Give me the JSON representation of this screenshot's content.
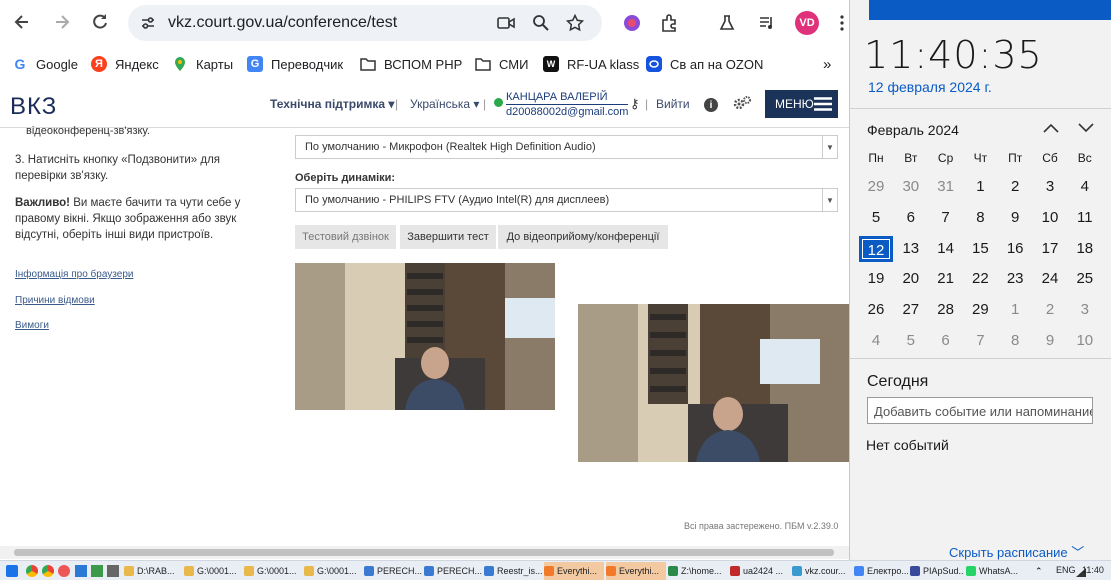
{
  "browser": {
    "url": "vkz.court.gov.ua/conference/test",
    "avatar_initials": "VD",
    "accent": "#e0327a"
  },
  "bookmarks": [
    {
      "label": "Google",
      "icon": "google-icon"
    },
    {
      "label": "Яндекс",
      "icon": "yandex-icon"
    },
    {
      "label": "Карты",
      "icon": "maps-pin-icon"
    },
    {
      "label": "Переводчик",
      "icon": "translate-icon"
    },
    {
      "label": "ВСПОМ PHP",
      "icon": "folder-icon"
    },
    {
      "label": "СМИ",
      "icon": "folder-icon"
    },
    {
      "label": "RF-UA klass",
      "icon": "rf-ua-icon"
    },
    {
      "label": "Св ап на OZON",
      "icon": "ozon-icon"
    }
  ],
  "site": {
    "logo": "ВКЗ",
    "support": "Технічна підтримка",
    "language": "Українська",
    "user_name": "КАНЦАРА ВАЛЕРІЙ",
    "user_email": "d20088002d@gmail.com",
    "logout": "Вийти",
    "menu": "МЕНЮ",
    "brand_color": "#1b3358"
  },
  "instructions": {
    "item2_tail": "відеоконференц-зв'язку.",
    "item3": "3. Натисніть кнопку «Подзвонити» для перевірки зв'язку.",
    "item4_bold": "Важливо!",
    "item4_text": " Ви маєте бачити та чути себе у правому вікні. Якщо зображення або звук відсутні, оберіть інші види пристроїв.",
    "links": [
      "Інформація про браузери",
      "Причини відмови",
      "Вимоги"
    ]
  },
  "form": {
    "microphone_value": "По умолчанию - Микрофон (Realtek High Definition Audio)",
    "speaker_label": "Оберіть динаміки:",
    "speaker_value": "По умолчанию - PHILIPS FTV (Аудио Intel(R) для дисплеев)",
    "btn_test_call": "Тестовий дзвінок",
    "btn_end_test": "Завершити тест",
    "btn_to_reception": "До відеоприйому/конференції"
  },
  "footer": "Всі права застережено. ПБМ v.2.39.0",
  "calendar": {
    "time": "11:40:35",
    "date": "12 февраля 2024 г.",
    "month": "Февраль 2024",
    "weekdays": [
      "Пн",
      "Вт",
      "Ср",
      "Чт",
      "Пт",
      "Сб",
      "Вс"
    ],
    "days": [
      "29",
      "30",
      "31",
      "1",
      "2",
      "3",
      "4",
      "5",
      "6",
      "7",
      "8",
      "9",
      "10",
      "11",
      "12",
      "13",
      "14",
      "15",
      "16",
      "17",
      "18",
      "19",
      "20",
      "21",
      "22",
      "23",
      "24",
      "25",
      "26",
      "27",
      "28",
      "29",
      "1",
      "2",
      "3",
      "4",
      "5",
      "6",
      "7",
      "8",
      "9",
      "10"
    ],
    "today": "12",
    "today_label": "Сегодня",
    "event_placeholder": "Добавить событие или напоминание",
    "no_events": "Нет событий",
    "hide_schedule": "Скрыть расписание",
    "accent": "#0a5bc4"
  },
  "taskbar": {
    "items": [
      "D:\\RAB...",
      "G:\\0001...",
      "G:\\0001...",
      "G:\\0001...",
      "PERECH...",
      "PERECH...",
      "Reestr_is...",
      "Everythi...",
      "Everythi...",
      "Z:\\home...",
      "ua2424 ...",
      "vkz.cour...",
      "Електро...",
      "PIApSud...",
      "WhatsA..."
    ],
    "lang": "ENG",
    "time": "11:40"
  }
}
